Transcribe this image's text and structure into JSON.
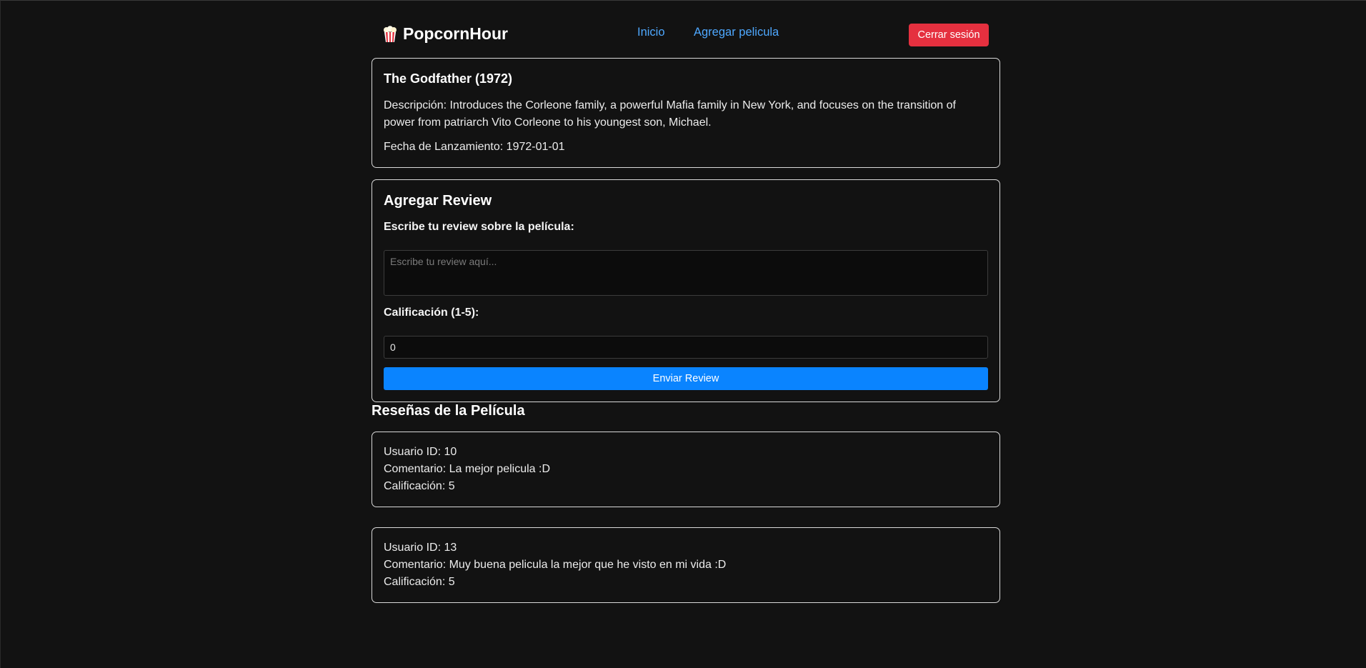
{
  "header": {
    "brand": "PopcornHour",
    "nav": {
      "home": "Inicio",
      "add_movie": "Agregar pelicula"
    },
    "logout": "Cerrar sesión"
  },
  "movie": {
    "title": "The Godfather (1972)",
    "description": "Descripción: Introduces the Corleone family, a powerful Mafia family in New York, and focuses on the transition of power from patriarch Vito Corleone to his youngest son, Michael.",
    "release_date": "Fecha de Lanzamiento: 1972-01-01"
  },
  "review_form": {
    "title": "Agregar Review",
    "review_label": "Escribe tu review sobre la película:",
    "review_placeholder": "Escribe tu review aquí...",
    "rating_label": "Calificación (1-5):",
    "rating_value": "0",
    "submit": "Enviar Review"
  },
  "reviews": {
    "heading": "Reseñas de la Película",
    "items": [
      {
        "user": "Usuario ID: 10",
        "comment": "Comentario: La mejor pelicula :D",
        "rating": "Calificación: 5"
      },
      {
        "user": "Usuario ID: 13",
        "comment": "Comentario: Muy buena pelicula la mejor que he visto en mi vida :D",
        "rating": "Calificación: 5"
      }
    ]
  },
  "colors": {
    "background": "#121212",
    "link": "#4ea8ff",
    "logout": "#e5303f",
    "primary": "#0a84ff"
  }
}
